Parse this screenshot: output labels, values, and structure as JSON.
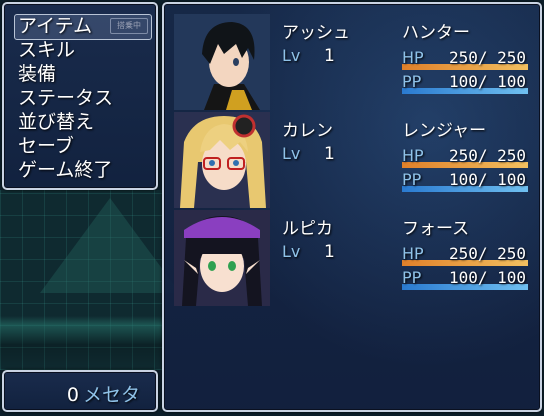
{
  "menu": {
    "items": [
      "アイテム",
      "スキル",
      "装備",
      "ステータス",
      "並び替え",
      "セーブ",
      "ゲーム終了"
    ],
    "scroll_hint": "搭乗中"
  },
  "gold": {
    "amount": "0",
    "unit": "メセタ"
  },
  "party": [
    {
      "name": "アッシュ",
      "class": "ハンター",
      "lv_label": "Lv",
      "level": "1",
      "hp_label": "HP",
      "hp": "250/ 250",
      "hp_ratio": 1.0,
      "pp_label": "PP",
      "pp": "100/ 100",
      "pp_ratio": 1.0
    },
    {
      "name": "カレン",
      "class": "レンジャー",
      "lv_label": "Lv",
      "level": "1",
      "hp_label": "HP",
      "hp": "250/ 250",
      "hp_ratio": 1.0,
      "pp_label": "PP",
      "pp": "100/ 100",
      "pp_ratio": 1.0
    },
    {
      "name": "ルピカ",
      "class": "フォース",
      "lv_label": "Lv",
      "level": "1",
      "hp_label": "HP",
      "hp": "250/ 250",
      "hp_ratio": 1.0,
      "pp_label": "PP",
      "pp": "100/ 100",
      "pp_ratio": 1.0
    }
  ],
  "colors": {
    "hp_gauge": [
      "#e0802a",
      "#f2c060"
    ],
    "pp_gauge": [
      "#2a7ad0",
      "#70c0f0"
    ],
    "system_text": "#8fc2e8"
  }
}
